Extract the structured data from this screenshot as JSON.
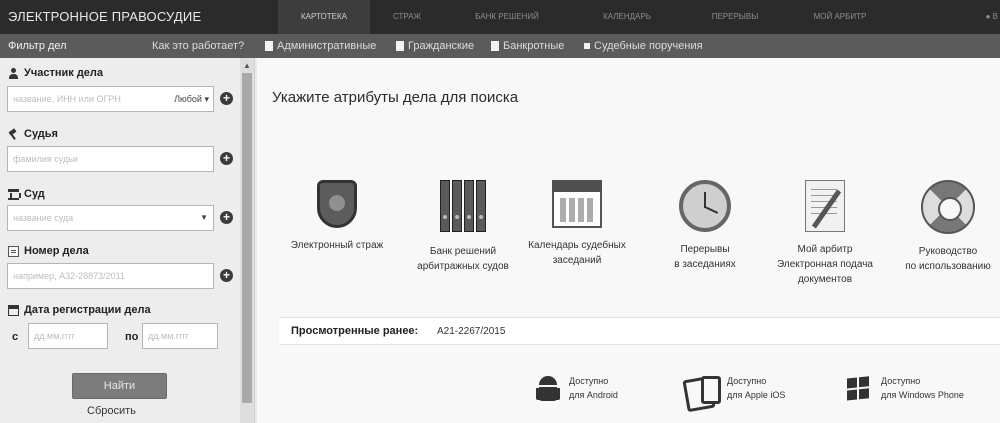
{
  "header": {
    "brand": "ЭЛЕКТРОННОЕ ПРАВОСУДИЕ",
    "tabs": [
      {
        "label": "КАРТОТЕКА",
        "active": true
      },
      {
        "label": "СТРАЖ",
        "active": false
      },
      {
        "label": "БАНК РЕШЕНИЙ",
        "active": false
      },
      {
        "label": "КАЛЕНДАРЬ",
        "active": false
      },
      {
        "label": "ПЕРЕРЫВЫ",
        "active": false
      },
      {
        "label": "МОЙ АРБИТР",
        "active": false
      }
    ],
    "more_label": "В"
  },
  "filterbar": {
    "title": "Фильтр дел",
    "howto": "Как это работает?",
    "categories": [
      {
        "label": "Административные",
        "icon": "doc-a-icon"
      },
      {
        "label": "Гражданские",
        "icon": "doc-g-icon"
      },
      {
        "label": "Банкротные",
        "icon": "doc-b-icon"
      },
      {
        "label": "Судебные поручения",
        "icon": "square-bullet-icon"
      }
    ]
  },
  "sidebar": {
    "participant": {
      "label": "Участник дела",
      "placeholder": "название, ИНН или ОГРН",
      "role": "Любой"
    },
    "judge": {
      "label": "Судья",
      "placeholder": "фамилия судьи"
    },
    "court": {
      "label": "Суд",
      "placeholder": "название суда"
    },
    "case_number": {
      "label": "Номер дела",
      "placeholder": "например, А32-28873/2011"
    },
    "reg_date": {
      "label": "Дата регистрации дела",
      "from_prefix": "с",
      "to_prefix": "по",
      "date_placeholder": "дд.мм.гггг"
    },
    "find_label": "Найти",
    "reset_label": "Сбросить"
  },
  "main": {
    "heading": "Укажите атрибуты дела для поиска",
    "tiles": [
      {
        "line1": "Электронный страж",
        "line2": "",
        "line3": "",
        "icon": "shield-icon"
      },
      {
        "line1": "Банк решений",
        "line2": "арбитражных судов",
        "line3": "",
        "icon": "binders-icon"
      },
      {
        "line1": "Календарь судебных",
        "line2": "заседаний",
        "line3": "",
        "icon": "calendar-icon"
      },
      {
        "line1": "Перерывы",
        "line2": "в заседаниях",
        "line3": "",
        "icon": "clock-icon"
      },
      {
        "line1": "Мой арбитр",
        "line2": "Электронная подача",
        "line3": "документов",
        "icon": "document-pen-icon"
      },
      {
        "line1": "Руководство",
        "line2": "по использованию",
        "line3": "",
        "icon": "lifebuoy-icon"
      }
    ],
    "recent": {
      "label": "Просмотренные ранее:",
      "value": "А21-2267/2015"
    },
    "apps": [
      {
        "line1": "Доступно",
        "line2": "для Android",
        "icon": "android-icon"
      },
      {
        "line1": "Доступно",
        "line2": "для Apple iOS",
        "icon": "tablet-icon"
      },
      {
        "line1": "Доступно",
        "line2": "для Windows Phone",
        "icon": "windows-icon"
      }
    ]
  }
}
